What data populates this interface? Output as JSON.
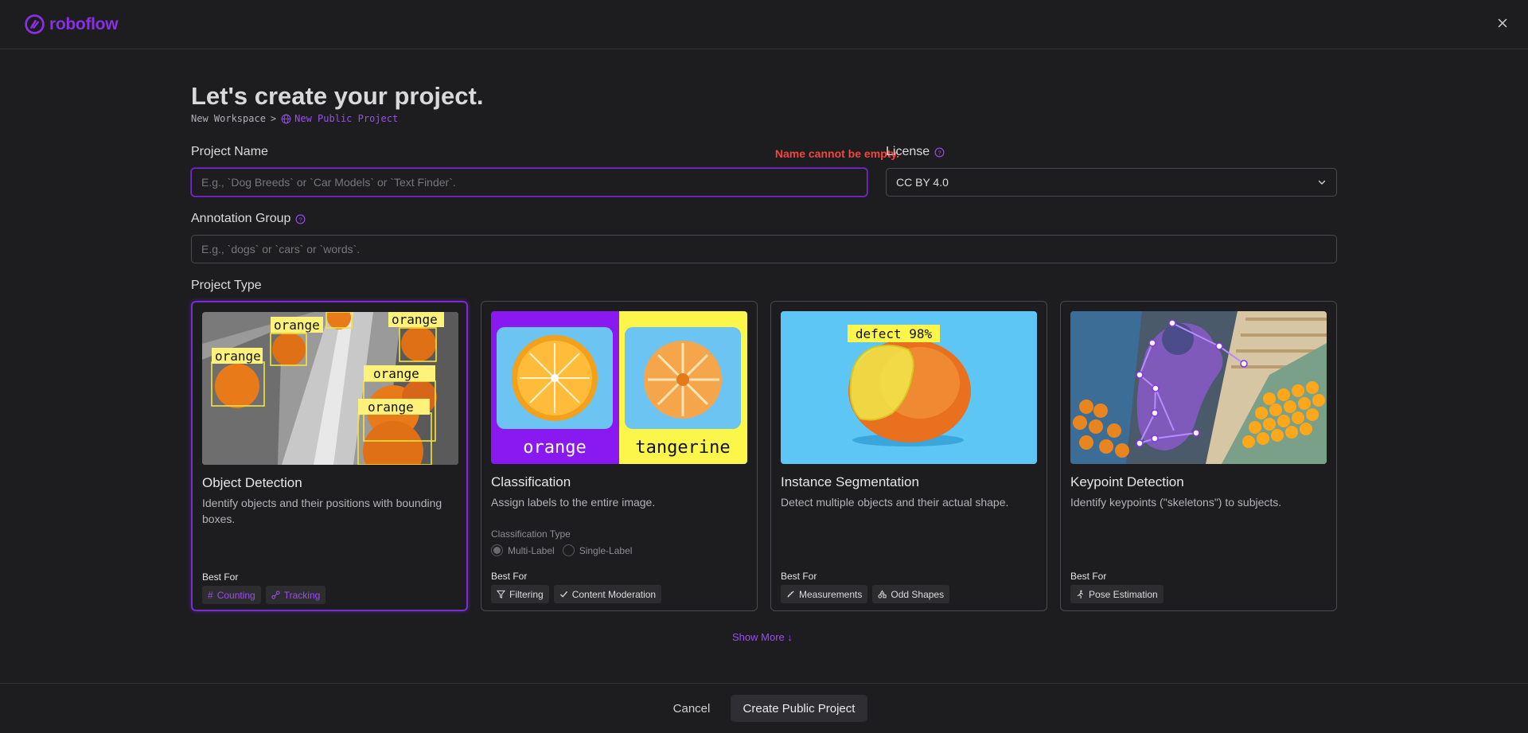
{
  "brand": {
    "name": "roboflow",
    "color": "#8a2fe6"
  },
  "header": {
    "close_icon": "close-icon"
  },
  "page": {
    "title": "Let's create your project.",
    "breadcrumb": {
      "workspace": "New Workspace",
      "separator": ">",
      "current": "New Public Project"
    }
  },
  "form": {
    "project_name": {
      "label": "Project Name",
      "error": "Name cannot be empty.",
      "value": "",
      "placeholder": "E.g., `Dog Breeds` or `Car Models` or `Text Finder`."
    },
    "license": {
      "label": "License",
      "value": "CC BY 4.0"
    },
    "annotation_group": {
      "label": "Annotation Group",
      "value": "",
      "placeholder": "E.g., `dogs` or `cars` or `words`."
    },
    "project_type_label": "Project Type"
  },
  "project_types": [
    {
      "title": "Object Detection",
      "description": "Identify objects and their positions with bounding boxes.",
      "best_for_label": "Best For",
      "chips": [
        "Counting",
        "Tracking"
      ],
      "selected": true,
      "image_labels": [
        "orange",
        "orange",
        "orange",
        "orange",
        "orange"
      ]
    },
    {
      "title": "Classification",
      "description": "Assign labels to the entire image.",
      "best_for_label": "Best For",
      "chips": [
        "Filtering",
        "Content Moderation"
      ],
      "selected": false,
      "classification_type": {
        "label": "Classification Type",
        "options": [
          "Multi-Label",
          "Single-Label"
        ],
        "selected": "Multi-Label"
      },
      "image_labels": [
        "orange",
        "tangerine"
      ]
    },
    {
      "title": "Instance Segmentation",
      "description": "Detect multiple objects and their actual shape.",
      "best_for_label": "Best For",
      "chips": [
        "Measurements",
        "Odd Shapes"
      ],
      "selected": false,
      "image_labels": [
        "defect 98%"
      ]
    },
    {
      "title": "Keypoint Detection",
      "description": "Identify keypoints (\"skeletons\") to subjects.",
      "best_for_label": "Best For",
      "chips": [
        "Pose Estimation"
      ],
      "selected": false
    }
  ],
  "show_more": "Show More",
  "footer": {
    "cancel": "Cancel",
    "create": "Create Public Project"
  },
  "colors": {
    "accent": "#7b2bd4",
    "error": "#f2463f",
    "background": "#1d1d1f"
  }
}
